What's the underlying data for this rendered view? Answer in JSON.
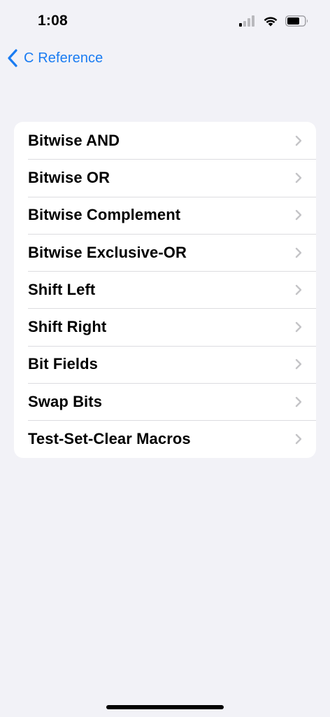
{
  "status_bar": {
    "time": "1:08",
    "icons": [
      "cellular-signal-icon",
      "wifi-icon",
      "battery-icon"
    ]
  },
  "nav": {
    "back_label": "C Reference",
    "accent_color": "#1a7cf2"
  },
  "list": {
    "items": [
      {
        "label": "Bitwise AND"
      },
      {
        "label": "Bitwise OR"
      },
      {
        "label": "Bitwise Complement"
      },
      {
        "label": "Bitwise Exclusive-OR"
      },
      {
        "label": "Shift Left"
      },
      {
        "label": "Shift Right"
      },
      {
        "label": "Bit Fields"
      },
      {
        "label": "Swap Bits"
      },
      {
        "label": "Test-Set-Clear Macros"
      }
    ]
  }
}
